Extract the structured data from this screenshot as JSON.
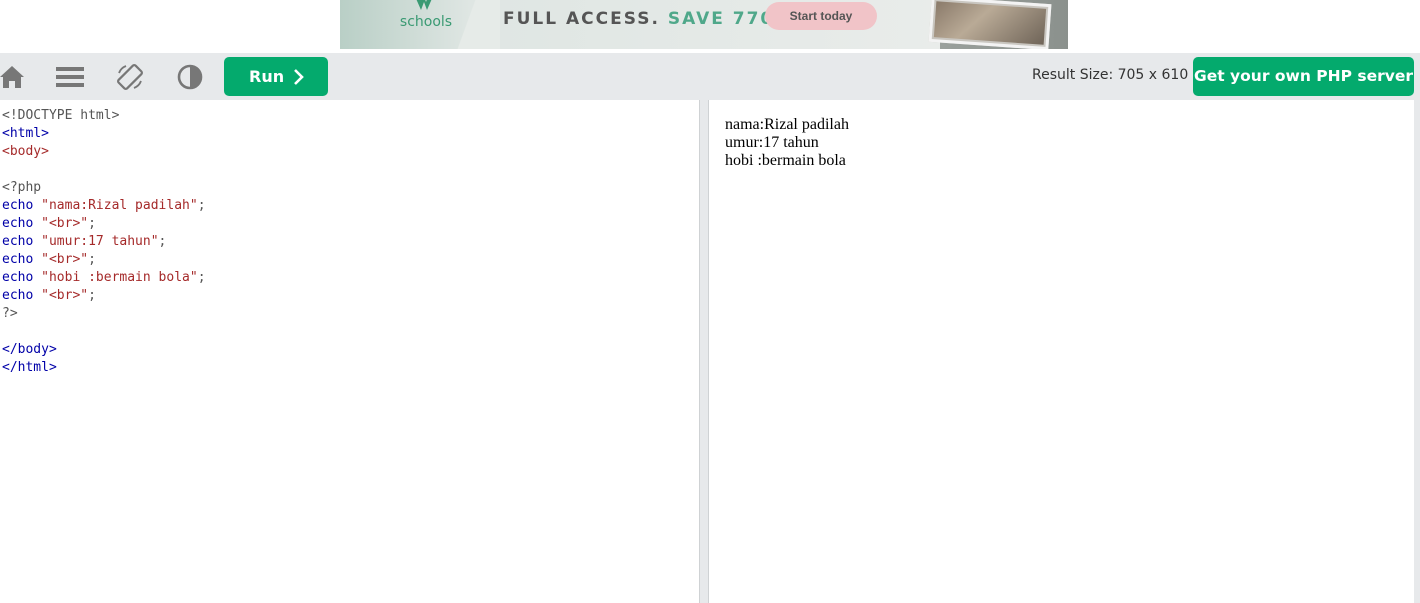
{
  "ad": {
    "logo_text": "schools",
    "headline_lead": "FULL ACCESS.",
    "headline_save": "SAVE 770$",
    "cta_label": "Start today"
  },
  "toolbar": {
    "icons": [
      "home-icon",
      "menu-icon",
      "rotate-icon",
      "contrast-icon"
    ],
    "run_label": "Run",
    "result_size": "Result Size: 705 x 610",
    "php_button_label": "Get your own PHP server"
  },
  "editor": {
    "lines": [
      [
        {
          "t": "<!DOCTYPE html>",
          "c": "plain"
        }
      ],
      [
        {
          "t": "<html>",
          "c": "tag-b"
        }
      ],
      [
        {
          "t": "<body>",
          "c": "tag"
        }
      ],
      [
        {
          "t": "",
          "c": "plain"
        }
      ],
      [
        {
          "t": "<?php",
          "c": "plain"
        }
      ],
      [
        {
          "t": "echo",
          "c": "kw"
        },
        {
          "t": " ",
          "c": "plain"
        },
        {
          "t": "\"nama:Rizal padilah\"",
          "c": "str"
        },
        {
          "t": ";",
          "c": "plain"
        }
      ],
      [
        {
          "t": "echo",
          "c": "kw"
        },
        {
          "t": " ",
          "c": "plain"
        },
        {
          "t": "\"<br>\"",
          "c": "str"
        },
        {
          "t": ";",
          "c": "plain"
        }
      ],
      [
        {
          "t": "echo",
          "c": "kw"
        },
        {
          "t": " ",
          "c": "plain"
        },
        {
          "t": "\"umur:17 tahun\"",
          "c": "str"
        },
        {
          "t": ";",
          "c": "plain"
        }
      ],
      [
        {
          "t": "echo",
          "c": "kw"
        },
        {
          "t": " ",
          "c": "plain"
        },
        {
          "t": "\"<br>\"",
          "c": "str"
        },
        {
          "t": ";",
          "c": "plain"
        }
      ],
      [
        {
          "t": "echo",
          "c": "kw"
        },
        {
          "t": " ",
          "c": "plain"
        },
        {
          "t": "\"hobi :bermain bola\"",
          "c": "str"
        },
        {
          "t": ";",
          "c": "plain"
        }
      ],
      [
        {
          "t": "echo",
          "c": "kw"
        },
        {
          "t": " ",
          "c": "plain"
        },
        {
          "t": "\"<br>\"",
          "c": "str"
        },
        {
          "t": ";",
          "c": "plain"
        }
      ],
      [
        {
          "t": "?>",
          "c": "plain"
        }
      ],
      [
        {
          "t": "",
          "c": "plain"
        }
      ],
      [
        {
          "t": "</body>",
          "c": "tag-b"
        }
      ],
      [
        {
          "t": "</html>",
          "c": "tag-b"
        }
      ]
    ]
  },
  "result": {
    "lines": [
      "nama:Rizal padilah",
      "umur:17 tahun",
      "hobi :bermain bola"
    ]
  },
  "colors": {
    "accent": "#04aa6d",
    "toolbar_bg": "#e7e9eb",
    "icon_gray": "#777777",
    "keyword": "#0000a8",
    "string": "#a52a2a"
  }
}
